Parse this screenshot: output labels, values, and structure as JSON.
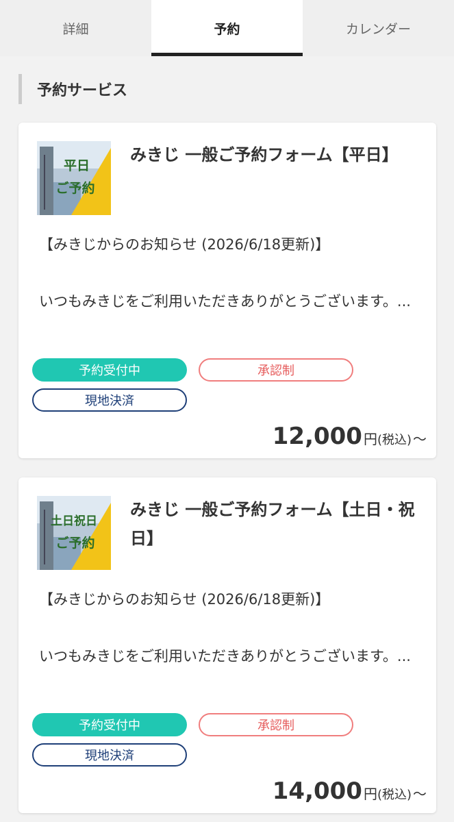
{
  "tabs": [
    {
      "label": "詳細",
      "active": false
    },
    {
      "label": "予約",
      "active": true
    },
    {
      "label": "カレンダー",
      "active": false
    }
  ],
  "section_title": "予約サービス",
  "services": [
    {
      "title": "みきじ 一般ご予約フォーム【平日】",
      "thumbnail_text": "平日ご予約",
      "notice": "【みきじからのお知らせ (2026/6/18更新)】",
      "description": "いつもみきじをご利用いただきありがとうございます。...",
      "badges": {
        "status": "予約受付中",
        "approval": "承認制",
        "payment": "現地決済"
      },
      "price": "12,000",
      "currency": "円",
      "tax_note": "(税込)",
      "suffix": "〜"
    },
    {
      "title": "みきじ 一般ご予約フォーム【土日・祝日】",
      "thumbnail_text": "土日祝日ご予約",
      "notice": "【みきじからのお知らせ (2026/6/18更新)】",
      "description": "いつもみきじをご利用いただきありがとうございます。...",
      "badges": {
        "status": "予約受付中",
        "approval": "承認制",
        "payment": "現地決済"
      },
      "price": "14,000",
      "currency": "円",
      "tax_note": "(税込)",
      "suffix": "〜"
    }
  ],
  "colors": {
    "accent_teal": "#20c7b2",
    "approval_red": "#f07d7d",
    "payment_navy": "#1e3f78",
    "tab_indicator": "#222222"
  }
}
